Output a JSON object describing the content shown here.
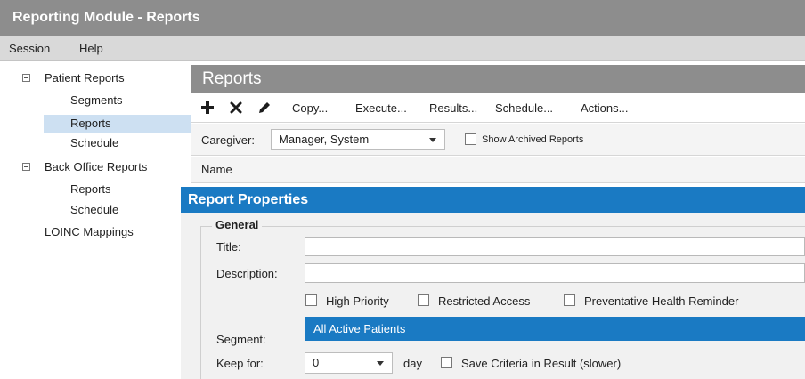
{
  "app": {
    "title": "Reporting Module - Reports"
  },
  "menu": {
    "items": [
      "Session",
      "Help"
    ]
  },
  "sidebar": {
    "groups": [
      {
        "label": "Patient Reports",
        "children": [
          "Segments",
          "Reports",
          "Schedule"
        ]
      },
      {
        "label": "Back Office Reports",
        "children": [
          "Reports",
          "Schedule"
        ]
      }
    ],
    "standalone": "LOINC Mappings",
    "selected": "Patient Reports / Reports"
  },
  "main": {
    "header": "Reports",
    "toolbar": {
      "icons": [
        "plus-icon",
        "close-icon",
        "pencil-icon"
      ],
      "copy": "Copy...",
      "execute": "Execute...",
      "results": "Results...",
      "schedule": "Schedule...",
      "actions": "Actions..."
    },
    "filter": {
      "caregiver_label": "Caregiver:",
      "caregiver_value": "Manager, System",
      "show_archived": "Show Archived Reports",
      "show_archived_checked": false
    },
    "list": {
      "column_name": "Name"
    }
  },
  "properties": {
    "header": "Report Properties",
    "group_title": "General",
    "title_label": "Title:",
    "title_value": "",
    "description_label": "Description:",
    "description_value": "",
    "checkboxes": [
      {
        "label": "High Priority",
        "checked": false
      },
      {
        "label": "Restricted Access",
        "checked": false
      },
      {
        "label": "Preventative Health Reminder",
        "checked": false
      }
    ],
    "segment_label": "Segment:",
    "segment_value": "All Active Patients",
    "keep_for_label": "Keep for:",
    "keep_for_value": "0",
    "keep_for_unit": "day",
    "save_criteria": {
      "label": "Save Criteria in Result (slower)",
      "checked": false
    }
  },
  "colors": {
    "accent": "#1a7ac3",
    "titlebar": "#8d8d8d",
    "selection": "#cde0f2"
  }
}
